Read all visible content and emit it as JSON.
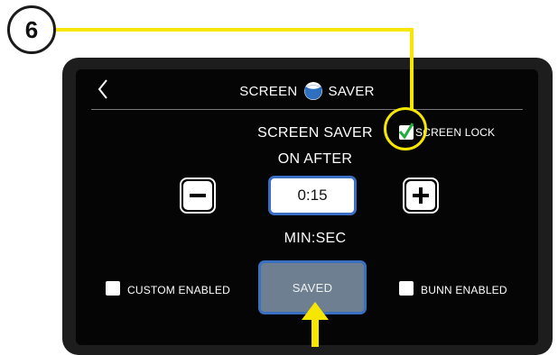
{
  "callout": {
    "number": "6"
  },
  "header": {
    "title_left": "SCREEN",
    "title_right": "SAVER"
  },
  "timer": {
    "label_line1": "SCREEN SAVER",
    "label_line2": "ON AFTER",
    "value": "0:15",
    "unit": "MIN:SEC"
  },
  "screen_lock": {
    "label": "SCREEN LOCK",
    "checked": true
  },
  "custom": {
    "label": "CUSTOM ENABLED",
    "checked": false
  },
  "bunn": {
    "label": "BUNN ENABLED",
    "checked": false
  },
  "saved_button": {
    "label": "SAVED"
  },
  "colors": {
    "callout_yellow": "#f7e600",
    "accent_blue": "#3a6fc4",
    "check_green": "#1fae3c",
    "saved_fill": "#6e7f92"
  }
}
